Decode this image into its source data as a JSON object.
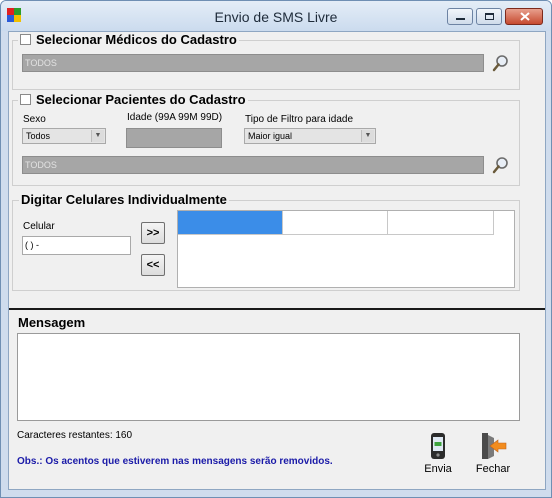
{
  "window": {
    "title": "Envio de SMS Livre"
  },
  "medicos": {
    "legend": "Selecionar Médicos do Cadastro",
    "value": "TODOS"
  },
  "pacientes": {
    "legend": "Selecionar Pacientes do Cadastro",
    "sexo_label": "Sexo",
    "sexo_value": "Todos",
    "idade_label": "Idade (99A 99M 99D)",
    "tipo_filtro_label": "Tipo de Filtro para idade",
    "tipo_filtro_value": "Maior igual",
    "value": "TODOS"
  },
  "celulares": {
    "legend": "Digitar Celulares Individualmente",
    "celular_label": "Celular",
    "celular_value": "(   )      -",
    "add_label": ">>",
    "remove_label": "<<"
  },
  "mensagem": {
    "title": "Mensagem",
    "caracteres_restantes": "Caracteres restantes: 160",
    "obs": "Obs.: Os acentos que estiverem nas mensagens serão removidos."
  },
  "toolbar": {
    "envia_label": "Envia",
    "fechar_label": "Fechar"
  },
  "colors": {
    "grid_selected": "#3b8de8",
    "obs_text": "#1a1aa8",
    "close_button": "#c64a2f"
  }
}
